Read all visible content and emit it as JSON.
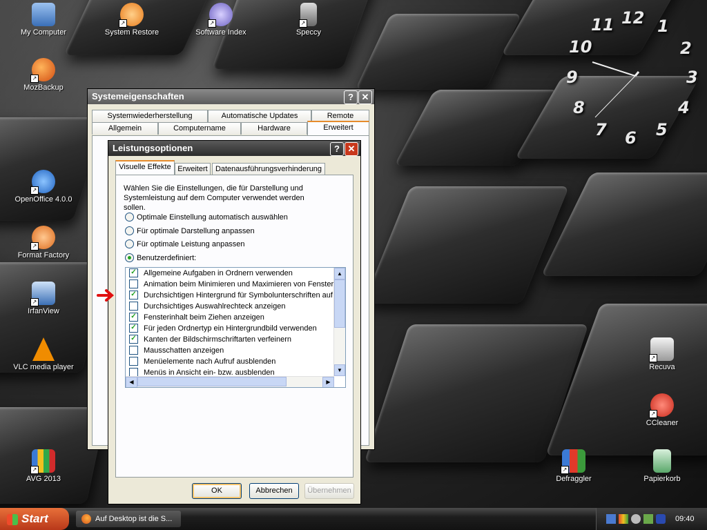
{
  "desktop": {
    "left_icons": [
      {
        "label": "My Computer",
        "color": "#5b8fd6"
      },
      {
        "label": "System Restore",
        "color": "#e98a2a"
      },
      {
        "label": "Software Index",
        "color": "#8a7fd0"
      },
      {
        "label": "Speccy",
        "color": "#999999"
      },
      {
        "label": "MozBackup",
        "color": "#e8691f"
      },
      {
        "label": "OpenOffice 4.0.0",
        "color": "#2f7ed6"
      },
      {
        "label": "Format Factory",
        "color": "#e6782c"
      },
      {
        "label": "IrfanView",
        "color": "#3b6fb5"
      },
      {
        "label": "VLC media player",
        "color": "#f08c00"
      },
      {
        "label": "AVG 2013",
        "color": "#d12b2b"
      }
    ],
    "right_icons": [
      {
        "label": "Recuva",
        "color": "#c9c9c9"
      },
      {
        "label": "CCleaner",
        "color": "#d23a2a"
      },
      {
        "label": "Defraggler",
        "color": "#3b8a3b"
      },
      {
        "label": "Papierkorb",
        "color": "#5aa86a"
      }
    ]
  },
  "clock_numbers": [
    "11",
    "12",
    "1",
    "10",
    "2",
    "9",
    "3",
    "8",
    "4",
    "7",
    "6",
    "5"
  ],
  "sys_window": {
    "title": "Systemeigenschaften",
    "help_btn": "?",
    "close_btn": "✕",
    "tabs_row1": [
      "Systemwiederherstellung",
      "Automatische Updates",
      "Remote"
    ],
    "tabs_row2": [
      "Allgemein",
      "Computername",
      "Hardware",
      "Erweitert"
    ]
  },
  "perf_window": {
    "title": "Leistungsoptionen",
    "help_btn": "?",
    "close_btn": "✕",
    "tabs": [
      "Visuelle Effekte",
      "Erweitert",
      "Datenausführungsverhinderung"
    ],
    "description": "Wählen Sie die Einstellungen, die für Darstellung und Systemleistung auf dem Computer verwendet werden sollen.",
    "radios": [
      {
        "label": "Optimale Einstellung automatisch auswählen",
        "selected": false
      },
      {
        "label": "Für optimale Darstellung anpassen",
        "selected": false
      },
      {
        "label": "Für optimale Leistung anpassen",
        "selected": false
      },
      {
        "label": "Benutzerdefiniert:",
        "selected": true
      }
    ],
    "checkboxes": [
      {
        "label": "Allgemeine Aufgaben in Ordnern verwenden",
        "checked": true
      },
      {
        "label": "Animation beim Minimieren und Maximieren von Fenstern",
        "checked": false
      },
      {
        "label": "Durchsichtigen Hintergrund für Symbolunterschriften auf d",
        "checked": true
      },
      {
        "label": "Durchsichtiges Auswahlrechteck anzeigen",
        "checked": false
      },
      {
        "label": "Fensterinhalt beim Ziehen anzeigen",
        "checked": true
      },
      {
        "label": "Für jeden Ordnertyp ein Hintergrundbild verwenden",
        "checked": true
      },
      {
        "label": "Kanten der Bildschirmschriftarten verfeinern",
        "checked": true
      },
      {
        "label": "Mausschatten anzeigen",
        "checked": false
      },
      {
        "label": "Menüelemente nach Aufruf ausblenden",
        "checked": false
      },
      {
        "label": "Menüs in Ansicht ein- bzw. ausblenden",
        "checked": false
      }
    ],
    "ok_label": "OK",
    "cancel_label": "Abbrechen",
    "apply_label": "Übernehmen"
  },
  "taskbar": {
    "start_label": "Start",
    "task_label": "Auf Desktop ist die S...",
    "time": "09:40"
  },
  "colors": {
    "arrow": "#e01010",
    "start_button": "#d9481a"
  }
}
